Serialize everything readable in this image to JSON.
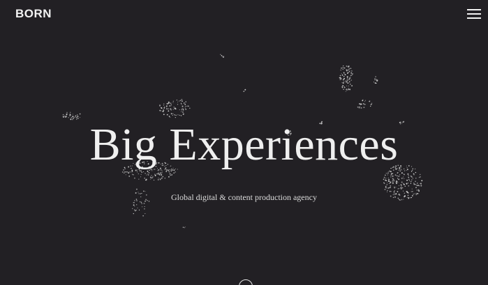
{
  "header": {
    "logo_text": "BORN",
    "menu_icon": "hamburger-menu-icon"
  },
  "hero": {
    "title": "Big Experiences",
    "subtitle": "Global digital & content production agency"
  },
  "scroll": {
    "icon": "scroll-down-circle-icon"
  },
  "colors": {
    "background": "#222024",
    "text": "#efefef",
    "particles": "#d8d8d8"
  }
}
